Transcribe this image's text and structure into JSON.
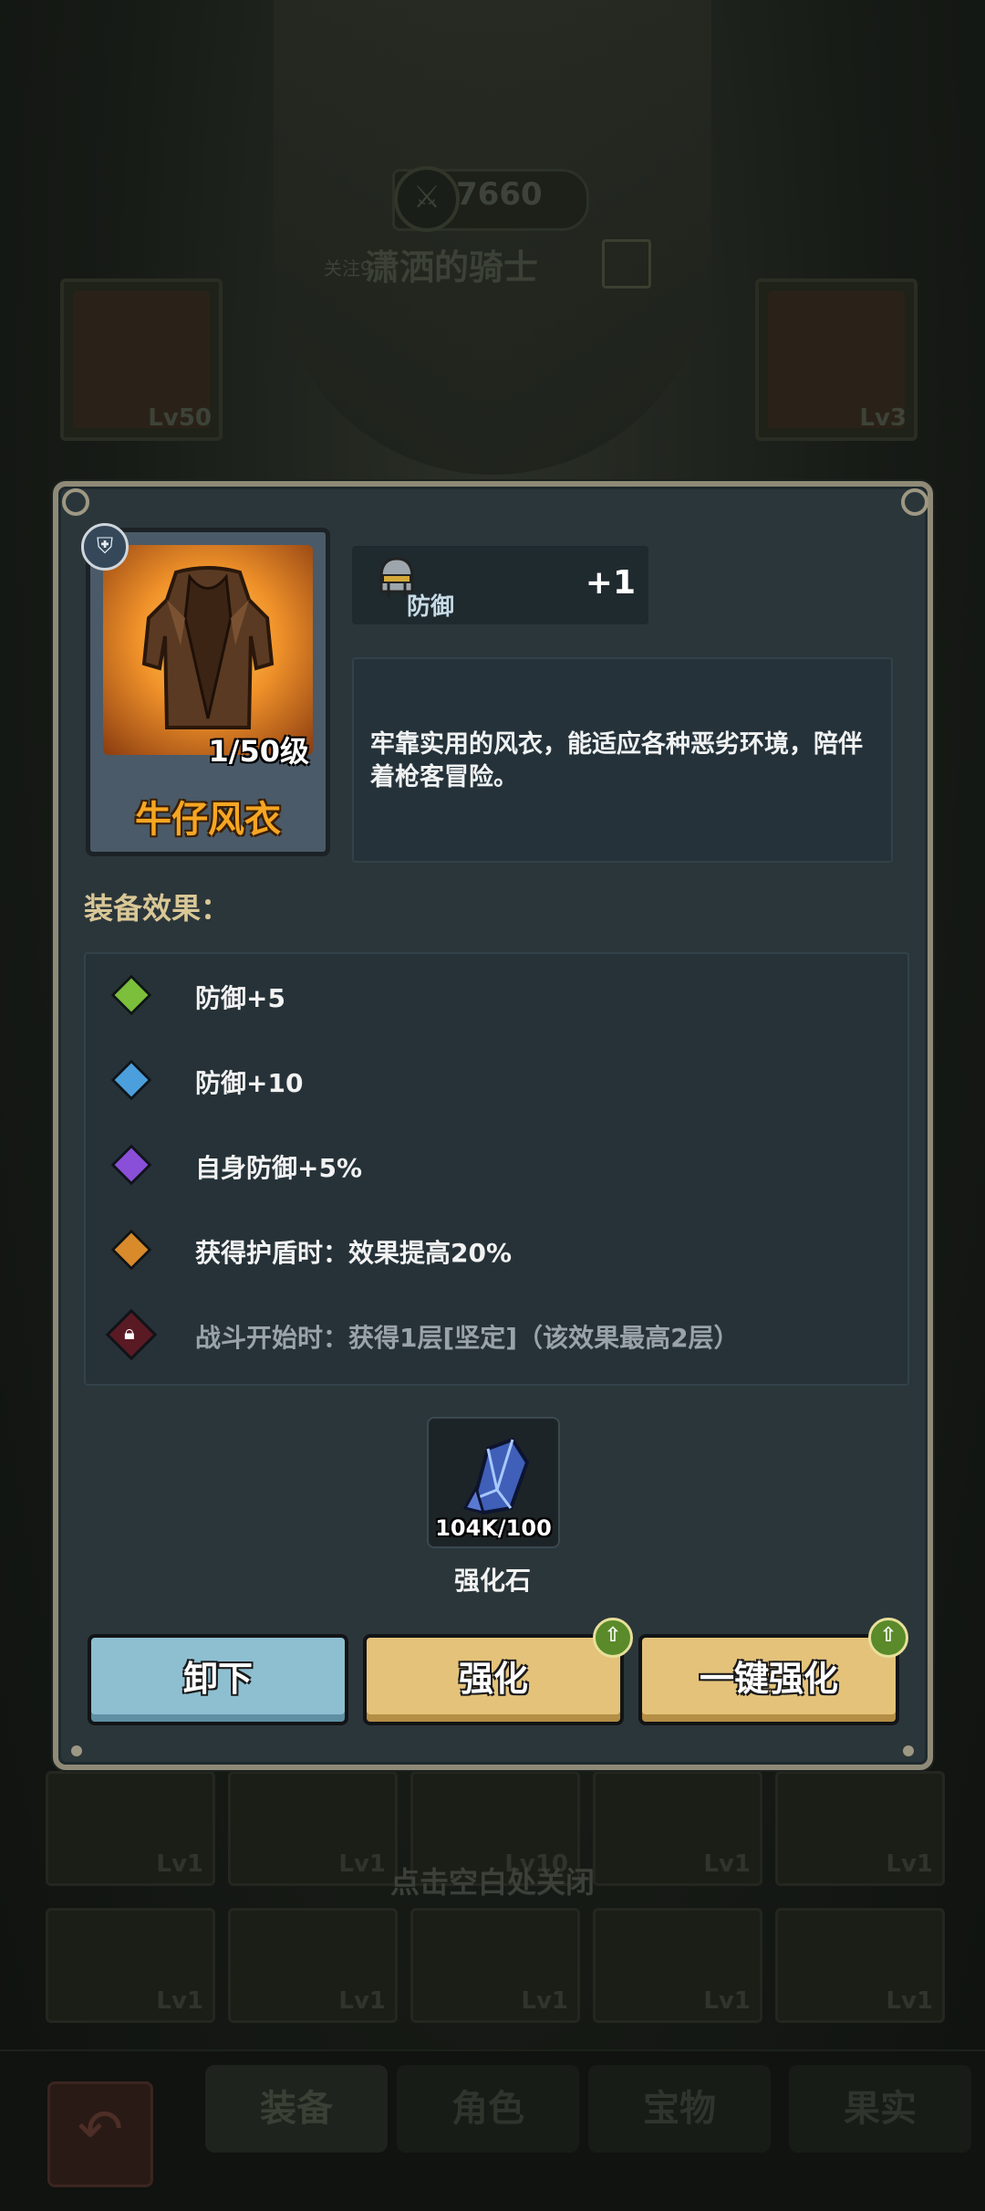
{
  "background": {
    "power": "7660",
    "follow_label": "关注9",
    "player_name": "潇洒的骑士",
    "left_slot_level": "Lv50",
    "right_slot_level": "Lv3",
    "row1_levels": [
      "Lv1",
      "Lv1",
      "Lv10",
      "Lv1",
      "Lv1"
    ],
    "row2_levels": [
      "Lv1",
      "Lv1",
      "Lv1",
      "Lv1",
      "Lv1"
    ],
    "close_hint": "点击空白处关闭",
    "nav_tabs": [
      "装备",
      "角色",
      "宝物",
      "果实"
    ]
  },
  "item": {
    "name": "牛仔风衣",
    "level": "1/50级",
    "stat_label": "防御",
    "stat_value": "+1",
    "description": "牢靠实用的风衣，能适应各种恶劣环境，陪伴着枪客冒险。"
  },
  "effects": {
    "title": "装备效果：",
    "items": [
      {
        "text": "防御+5",
        "color": "#7bbf3a",
        "locked": false
      },
      {
        "text": "防御+10",
        "color": "#4b9fdc",
        "locked": false
      },
      {
        "text": "自身防御+5%",
        "color": "#8a4fd8",
        "locked": false
      },
      {
        "text": "获得护盾时：效果提高20%",
        "color": "#d98a2a",
        "locked": false
      },
      {
        "text": "战斗开始时：获得1层[坚定]（该效果最高2层）",
        "color": "#5a1a24",
        "locked": true
      }
    ]
  },
  "material": {
    "count": "104K/100",
    "name": "强化石"
  },
  "buttons": {
    "unequip": "卸下",
    "upgrade": "强化",
    "one_click_upgrade": "一键强化"
  }
}
